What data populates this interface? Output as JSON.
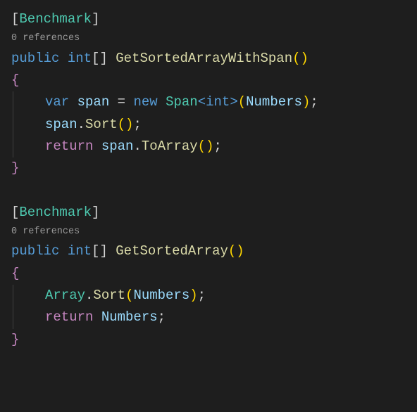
{
  "method1": {
    "attribute_open": "[",
    "attribute_name": "Benchmark",
    "attribute_close": "]",
    "codelens": "0 references",
    "modifier": "public",
    "return_type": "int",
    "array_brackets": "[]",
    "method_name": "GetSortedArrayWithSpan",
    "parens": "()",
    "open_brace": "{",
    "line1": {
      "var": "var",
      "varname": "span",
      "equals": " = ",
      "new": "new",
      "span_type": "Span",
      "lt": "<",
      "inner_type": "int",
      "gt": ">",
      "open_paren": "(",
      "arg": "Numbers",
      "close_paren": ")",
      "semi": ";"
    },
    "line2": {
      "varname": "span",
      "dot": ".",
      "method": "Sort",
      "parens": "()",
      "semi": ";"
    },
    "line3": {
      "return": "return",
      "varname": "span",
      "dot": ".",
      "method": "ToArray",
      "parens": "()",
      "semi": ";"
    },
    "close_brace": "}"
  },
  "method2": {
    "attribute_open": "[",
    "attribute_name": "Benchmark",
    "attribute_close": "]",
    "codelens": "0 references",
    "modifier": "public",
    "return_type": "int",
    "array_brackets": "[]",
    "method_name": "GetSortedArray",
    "parens": "()",
    "open_brace": "{",
    "line1": {
      "class": "Array",
      "dot": ".",
      "method": "Sort",
      "open_paren": "(",
      "arg": "Numbers",
      "close_paren": ")",
      "semi": ";"
    },
    "line2": {
      "return": "return",
      "arg": "Numbers",
      "semi": ";"
    },
    "close_brace": "}"
  }
}
